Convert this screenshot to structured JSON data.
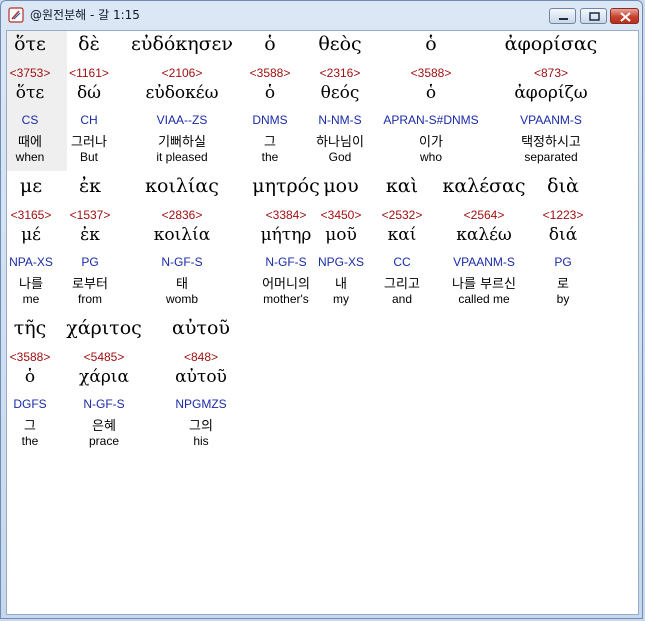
{
  "window": {
    "title": "@원전분해 - 갈 1:15"
  },
  "rows": [
    {
      "tokens": [
        {
          "greek": "ὅτε",
          "strong": "<3753>",
          "lemma": "ὅτε",
          "parse": "CS",
          "korean": "때에",
          "english": "when"
        },
        {
          "greek": "δὲ",
          "strong": "<1161>",
          "lemma": "δώ",
          "parse": "CH",
          "korean": "그러나",
          "english": "But"
        },
        {
          "greek": "εὐδόκησεν",
          "strong": "<2106>",
          "lemma": "εὐδοκέω",
          "parse": "VIAA--ZS",
          "korean": "기뻐하실",
          "english": "it pleased"
        },
        {
          "greek": "ὁ",
          "strong": "<3588>",
          "lemma": "ὁ",
          "parse": "DNMS",
          "korean": "그",
          "english": "the"
        },
        {
          "greek": "θεὸς",
          "strong": "<2316>",
          "lemma": "θεός",
          "parse": "N-NM-S",
          "korean": "하나님이",
          "english": "God"
        },
        {
          "greek": "ὁ",
          "strong": "<3588>",
          "lemma": "ὁ",
          "parse": "APRAN-S#DNMS",
          "korean": "이가",
          "english": "who"
        },
        {
          "greek": "ἀφορίσας",
          "strong": "<873>",
          "lemma": "ἀφορίζω",
          "parse": "VPAANM-S",
          "korean": "택정하시고",
          "english": "separated"
        }
      ]
    },
    {
      "tokens": [
        {
          "greek": "με",
          "strong": "<3165>",
          "lemma": "μέ",
          "parse": "NPA-XS",
          "korean": "나를",
          "english": "me"
        },
        {
          "greek": "ἐκ",
          "strong": "<1537>",
          "lemma": "ἐκ",
          "parse": "PG",
          "korean": "로부터",
          "english": "from"
        },
        {
          "greek": "κοιλίας",
          "strong": "<2836>",
          "lemma": "κοιλία",
          "parse": "N-GF-S",
          "korean": "태",
          "english": "womb"
        },
        {
          "greek": "μητρός",
          "strong": "<3384>",
          "lemma": "μήτηρ",
          "parse": "N-GF-S",
          "korean": "어머니의",
          "english": "mother's"
        },
        {
          "greek": "μου",
          "strong": "<3450>",
          "lemma": "μοῦ",
          "parse": "NPG-XS",
          "korean": "내",
          "english": "my"
        },
        {
          "greek": "καὶ",
          "strong": "<2532>",
          "lemma": "καί",
          "parse": "CC",
          "korean": "그리고",
          "english": "and"
        },
        {
          "greek": "καλέσας",
          "strong": "<2564>",
          "lemma": "καλέω",
          "parse": "VPAANM-S",
          "korean": "나를 부르신",
          "english": "called me"
        },
        {
          "greek": "διὰ",
          "strong": "<1223>",
          "lemma": "διά",
          "parse": "PG",
          "korean": "로",
          "english": "by"
        }
      ]
    },
    {
      "tokens": [
        {
          "greek": "τῆς",
          "strong": "<3588>",
          "lemma": "ὁ",
          "parse": "DGFS",
          "korean": "그",
          "english": "the"
        },
        {
          "greek": "χάριτος",
          "strong": "<5485>",
          "lemma": "χάρια",
          "parse": "N-GF-S",
          "korean": "은혜",
          "english": "prace"
        },
        {
          "greek": "αὐτοῦ",
          "strong": "<848>",
          "lemma": "αὐτοῦ",
          "parse": "NPGMZS",
          "korean": "그의",
          "english": "his"
        }
      ]
    }
  ],
  "colors": {
    "strong": "#a01010",
    "parse": "#1a2aa8",
    "highlight": "#efefef"
  }
}
